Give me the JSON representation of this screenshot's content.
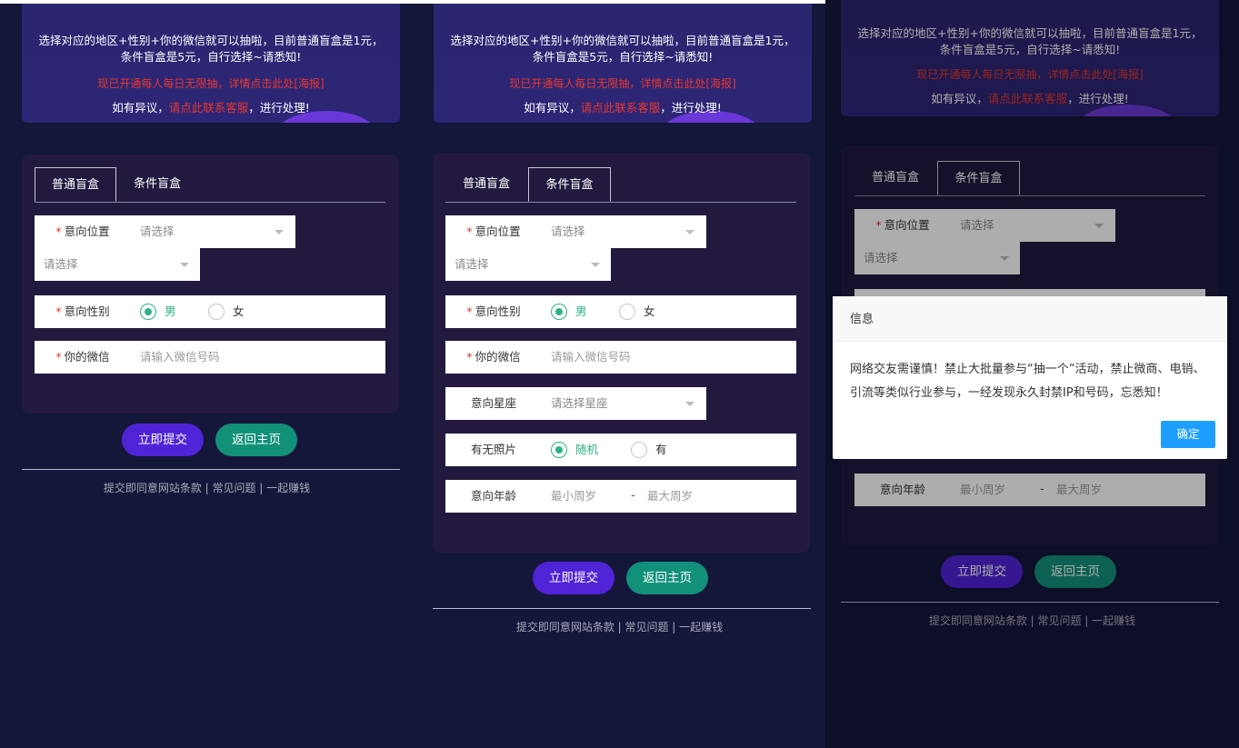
{
  "banner": {
    "line1": "选择对应的地区+性别+你的微信就可以抽啦，目前普通盲盒是1元，",
    "line2": "条件盲盒是5元，自行选择~请悉知!",
    "red_line": "现已开通每人每日无限抽，详情点击此处[海报]",
    "contact_prefix": "如有异议，",
    "contact_link": "请点此联系客服",
    "contact_suffix": "，进行处理!"
  },
  "tabs": {
    "normal": "普通盲盒",
    "conditional": "条件盲盒"
  },
  "form": {
    "location_label": "意向位置",
    "location_placeholder": "请选择",
    "sub_location_placeholder": "请选择",
    "gender_label": "意向性别",
    "gender_male": "男",
    "gender_female": "女",
    "wechat_label": "你的微信",
    "wechat_placeholder": "请输入微信号码",
    "zodiac_label": "意向星座",
    "zodiac_placeholder": "请选择星座",
    "photo_label": "有无照片",
    "photo_random": "随机",
    "photo_yes": "有",
    "age_label": "意向年龄",
    "age_min_placeholder": "最小周岁",
    "age_separator": "-",
    "age_max_placeholder": "最大周岁"
  },
  "buttons": {
    "submit": "立即提交",
    "home": "返回主页"
  },
  "footer": "提交即同意网站条款 | 常见问题 | 一起赚钱",
  "dialog": {
    "title": "信息",
    "body": "网络交友需谨慎！禁止大批量参与“抽一个”活动，禁止微商、电销、引流等类似行业参与，一经发现永久封禁IP和号码，忘悉知！",
    "confirm": "确定"
  },
  "colors": {
    "background": "#14163a",
    "submit": "#4f24d6",
    "home": "#12907a",
    "checked": "#2cb286",
    "required": "#e8362f",
    "dialog_button": "#1e9fff"
  }
}
